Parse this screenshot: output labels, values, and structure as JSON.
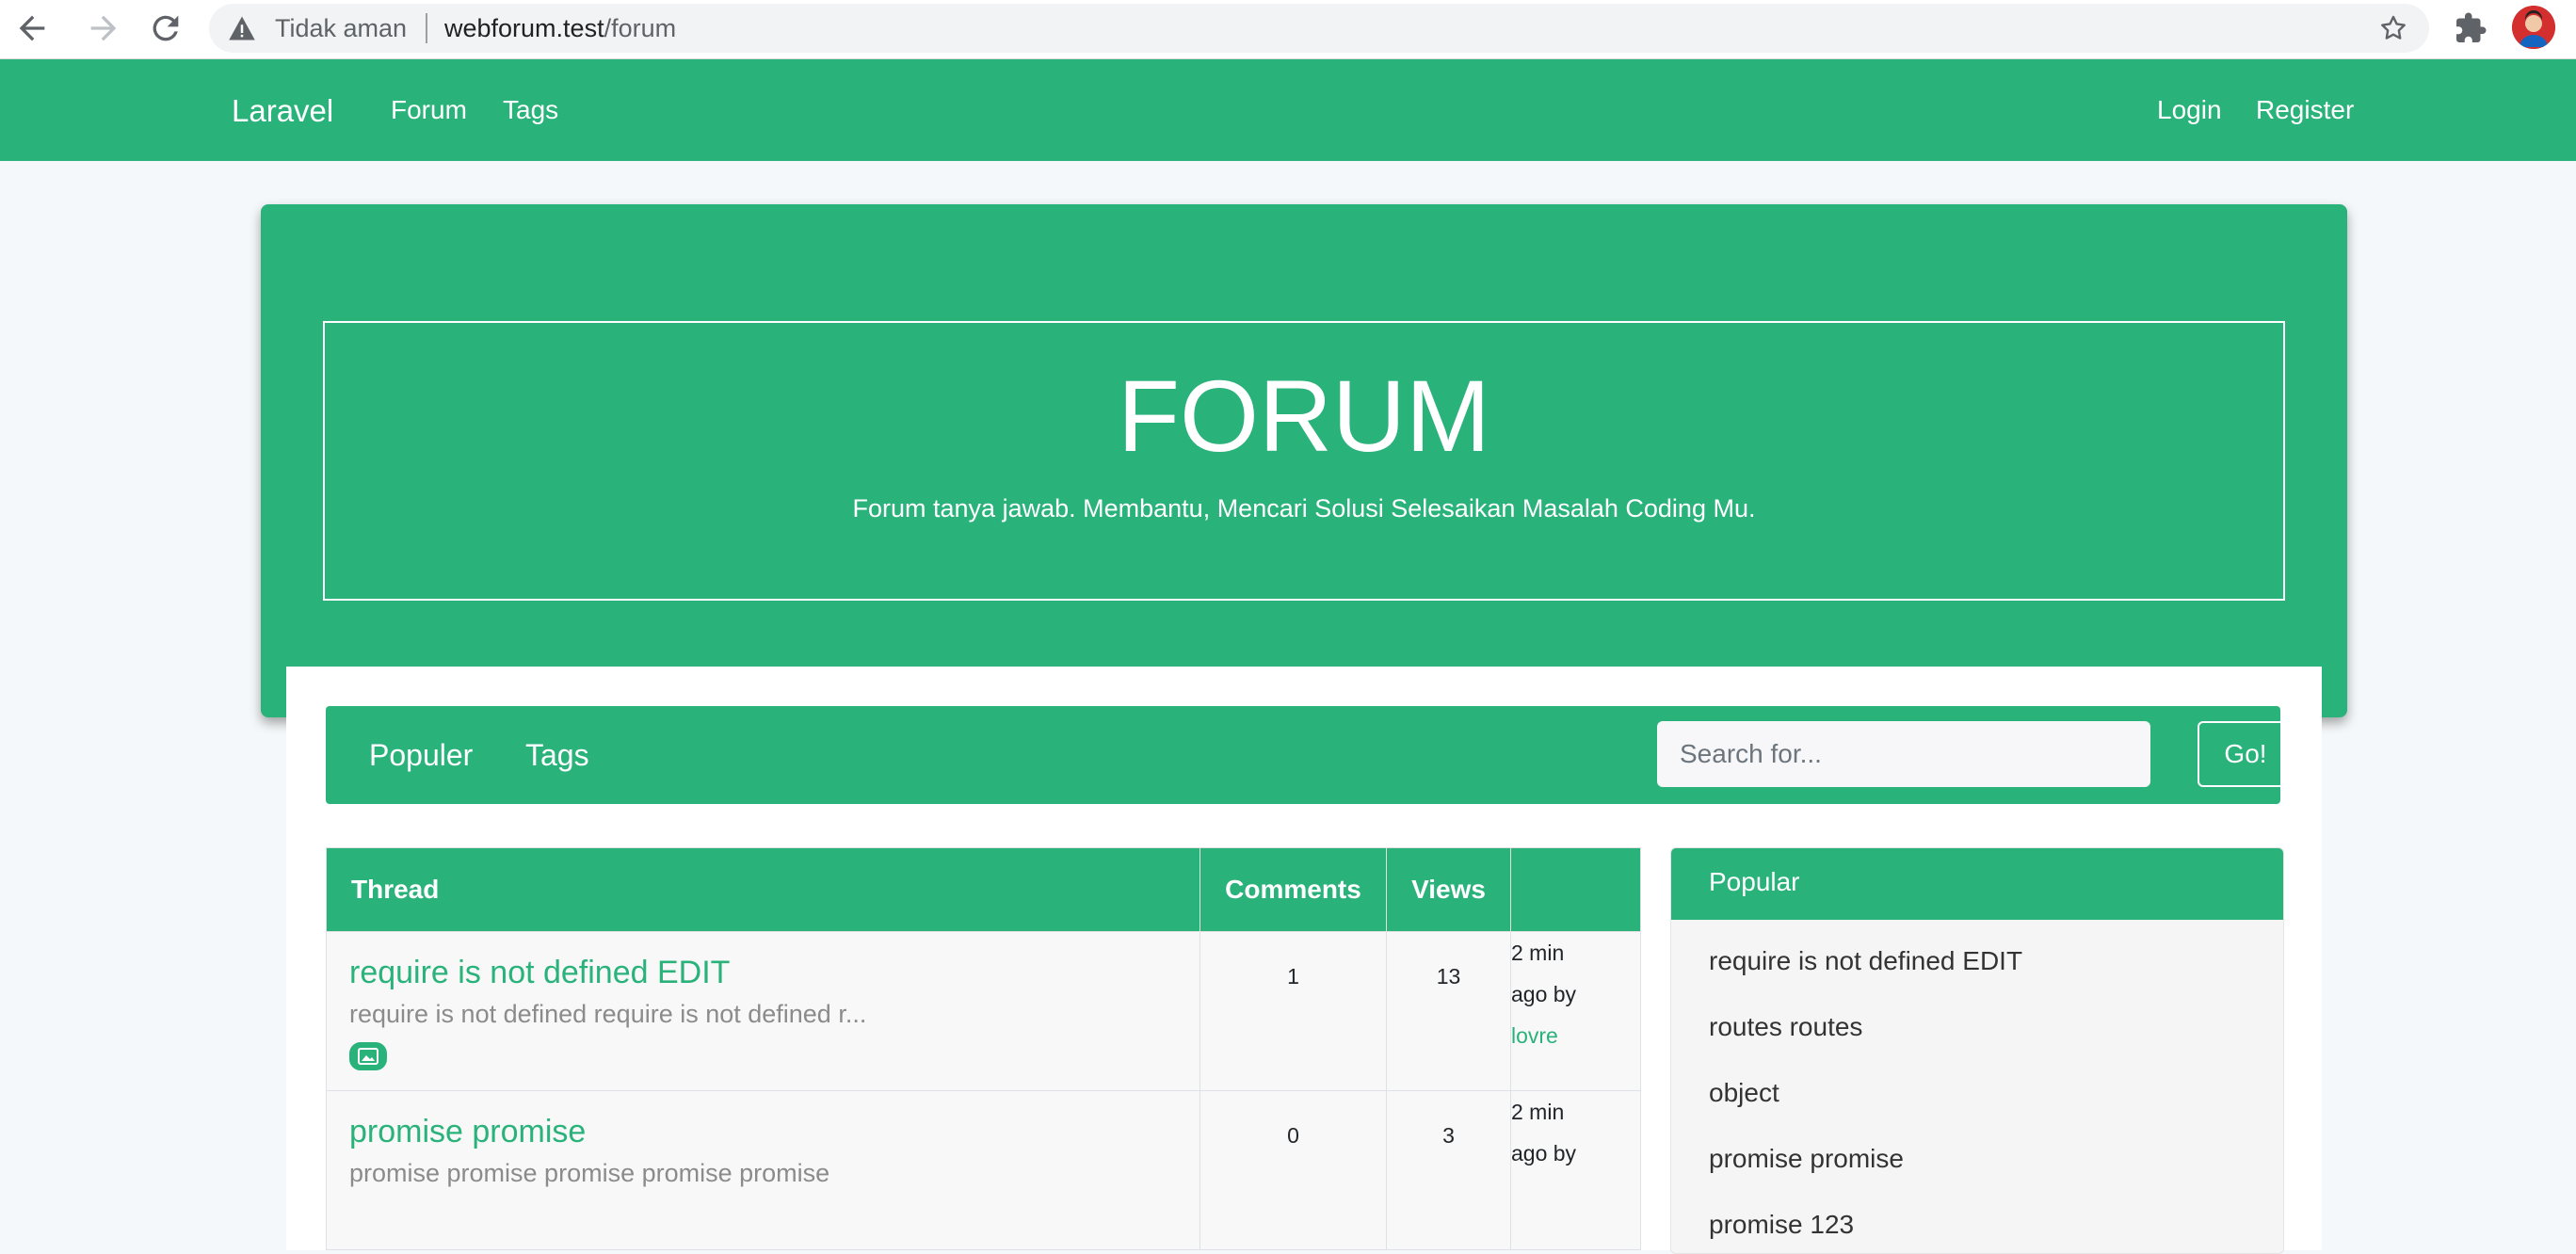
{
  "browser": {
    "security_label": "Tidak aman",
    "url_host": "webforum.test",
    "url_path": "/forum"
  },
  "navbar": {
    "brand": "Laravel",
    "links": [
      "Forum",
      "Tags"
    ],
    "auth": [
      "Login",
      "Register"
    ]
  },
  "hero": {
    "title": "FORUM",
    "subtitle": "Forum tanya jawab. Membantu, Mencari Solusi Selesaikan Masalah Coding Mu."
  },
  "subnav": {
    "links": [
      "Populer",
      "Tags"
    ],
    "search_placeholder": "Search for...",
    "search_button": "Go!"
  },
  "threads": {
    "headers": [
      "Thread",
      "Comments",
      "Views",
      ""
    ],
    "rows": [
      {
        "title": "require is not defined EDIT",
        "excerpt": "require is not defined require is not defined r...",
        "comments": "1",
        "views": "13",
        "time": "2 min",
        "ago": "ago by",
        "user": "lovre"
      },
      {
        "title": "promise promise",
        "excerpt": "promise promise promise promise promise",
        "comments": "0",
        "views": "3",
        "time": "2 min",
        "ago": "ago by"
      }
    ]
  },
  "popular": {
    "header": "Popular",
    "items": [
      "require is not defined EDIT",
      "routes routes",
      "object",
      "promise promise",
      "promise 123"
    ]
  },
  "colors": {
    "accent": "#2ab27b",
    "page_bg": "#f5f8fa"
  }
}
